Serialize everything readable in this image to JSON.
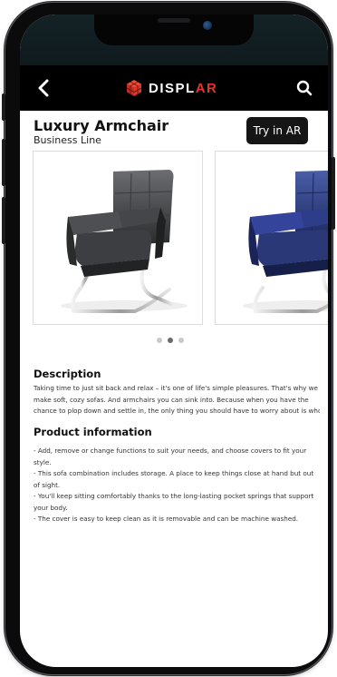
{
  "header": {
    "brand_prefix": "DISPL",
    "brand_suffix": "AR",
    "brand_accent_color": "#e0352b"
  },
  "product": {
    "title": "Luxury Armchair",
    "subtitle": "Business Line",
    "ar_button_label": "Try in AR",
    "carousel": {
      "slides": [
        "black leather armchair",
        "blue leather armchair"
      ],
      "active_dot_index": 1,
      "dot_count": 3
    }
  },
  "description": {
    "heading": "Description",
    "lines": [
      "Taking time to just sit back and relax – it's one of life's simple pleasures. That's why we",
      "make soft, cozy sofas. And armchairs you can sink into. Because when you have the",
      "chance to plop down and settle in, the only thing you should have to worry about is who's"
    ]
  },
  "product_information": {
    "heading": "Product information",
    "items": [
      "- Add, remove or change functions to suit your needs, and choose covers to fit your style.",
      "- This sofa combination includes storage. A place to keep things close at hand but out of sight.",
      "- You'll keep sitting comfortably thanks to the long-lasting pocket springs that support your body.",
      "- The cover is easy to keep clean as it is removable and can be machine washed."
    ]
  }
}
